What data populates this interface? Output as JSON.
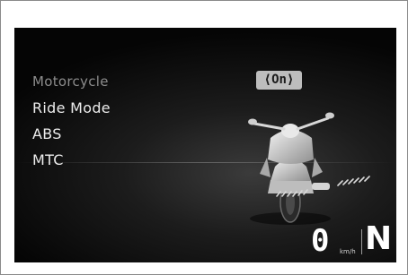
{
  "menu": {
    "title": "Motorcycle",
    "items": [
      {
        "label": "Ride Mode"
      },
      {
        "label": "ABS"
      },
      {
        "label": "MTC"
      }
    ]
  },
  "selection": {
    "value": "On",
    "display": "⟨On⟩"
  },
  "status": {
    "speed": "0",
    "speed_unit": "km/h",
    "gear": "N"
  },
  "icons": {
    "motorcycle": "motorcycle-icon",
    "traction": "traction-chevrons-icon"
  },
  "colors": {
    "screen_bg": "#050505",
    "text": "#ececec",
    "header_text": "#8c8c8c",
    "badge_bg": "#bdbdbd"
  }
}
